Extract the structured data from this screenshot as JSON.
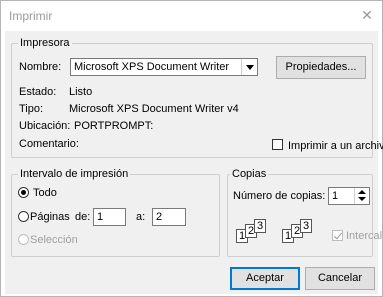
{
  "window": {
    "title": "Imprimir"
  },
  "printer": {
    "legend": "Impresora",
    "name_label": "Nombre:",
    "name_value": "Microsoft XPS Document Writer",
    "properties_label": "Propiedades...",
    "status_label": "Estado:",
    "status_value": "Listo",
    "type_label": "Tipo:",
    "type_value": "Microsoft XPS Document Writer v4",
    "location_label": "Ubicación:",
    "location_value": "PORTPROMPT:",
    "comment_label": "Comentario:",
    "print_to_file_label": "Imprimir a un archivo"
  },
  "range": {
    "legend": "Intervalo de impresión",
    "all_label": "Todo",
    "pages_label": "Páginas",
    "from_label": "de:",
    "from_value": "1",
    "to_label": "a:",
    "to_value": "2",
    "selection_label": "Selección",
    "selected": "all"
  },
  "copies": {
    "legend": "Copias",
    "count_label": "Número de copias:",
    "count_value": "1",
    "collate_label": "Intercal",
    "collate_checked": true,
    "pages": [
      "1",
      "2",
      "3"
    ]
  },
  "footer": {
    "ok_label": "Aceptar",
    "cancel_label": "Cancelar"
  }
}
